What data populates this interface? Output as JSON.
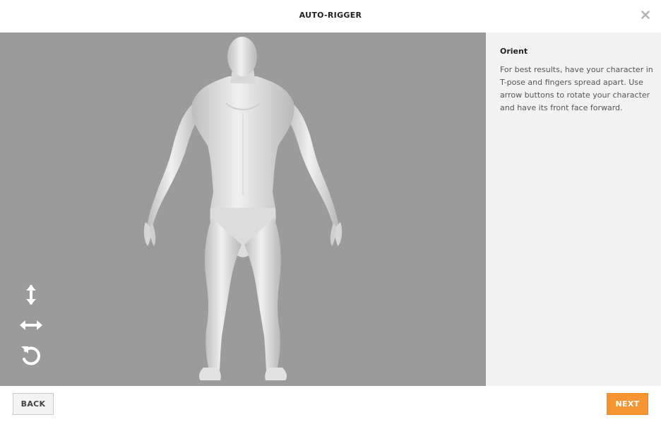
{
  "header": {
    "title": "AUTO-RIGGER",
    "close_icon": "close-icon"
  },
  "viewport": {
    "background": "#9b9b9b",
    "tools": [
      {
        "name": "vertical-arrows-icon",
        "glyph": "↕"
      },
      {
        "name": "horizontal-arrows-icon",
        "glyph": "↔"
      },
      {
        "name": "rotate-icon",
        "glyph": "↺"
      }
    ]
  },
  "panel": {
    "heading": "Orient",
    "body": "For best results, have your character in T-pose and fingers spread apart. Use arrow buttons to rotate your character and have its front face forward."
  },
  "footer": {
    "back_label": "BACK",
    "next_label": "NEXT",
    "accent": "#f6952f"
  }
}
